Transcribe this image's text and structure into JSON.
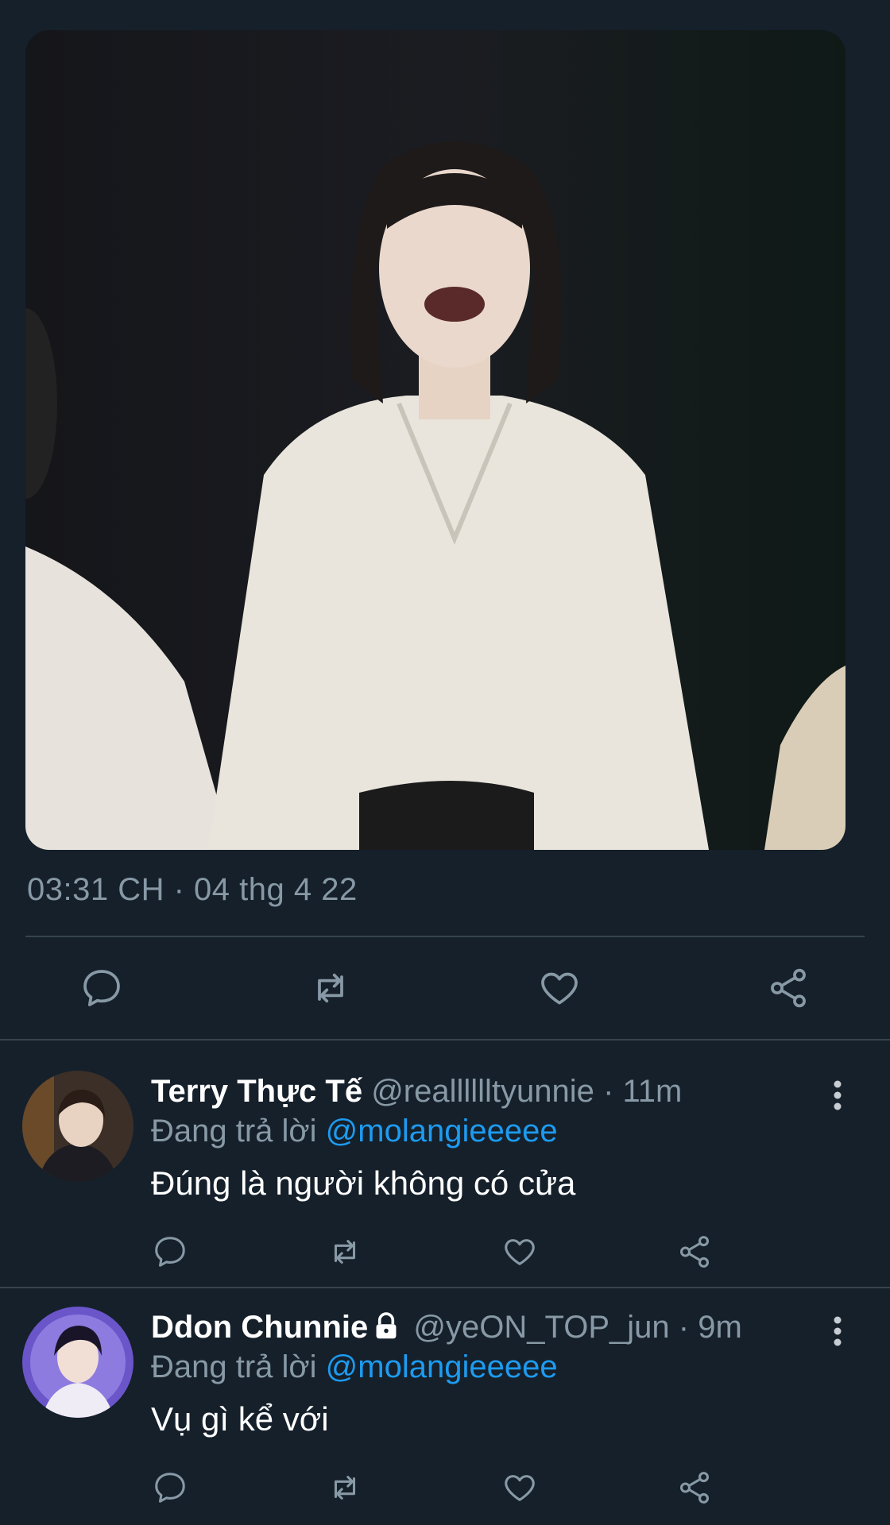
{
  "tweet": {
    "media": {
      "description_icon": "photo"
    },
    "timestamp": "03:31 CH · 04 thg 4 22",
    "actions": {
      "reply_icon": "comment-icon",
      "retweet_icon": "retweet-icon",
      "like_icon": "heart-icon",
      "share_icon": "share-icon"
    }
  },
  "replies": [
    {
      "name": "Terry Thực Tế",
      "handle": "@realllllltyunnie",
      "separator": "·",
      "time": "11m",
      "replying_label": "Đang trả lời",
      "replying_to": "@molangieeeee",
      "text": "Đúng là người không có cửa",
      "locked": false
    },
    {
      "name": "Ddon Chunnie",
      "handle": "@yeON_TOP_jun",
      "separator": "·",
      "time": "9m",
      "replying_label": "Đang trả lời",
      "replying_to": "@molangieeeee",
      "text": "Vụ gì kể với",
      "locked": true
    }
  ],
  "colors": {
    "background": "#15202b",
    "secondary_text": "#8899a6",
    "accent": "#1d9bf0",
    "divider": "#38444d"
  }
}
